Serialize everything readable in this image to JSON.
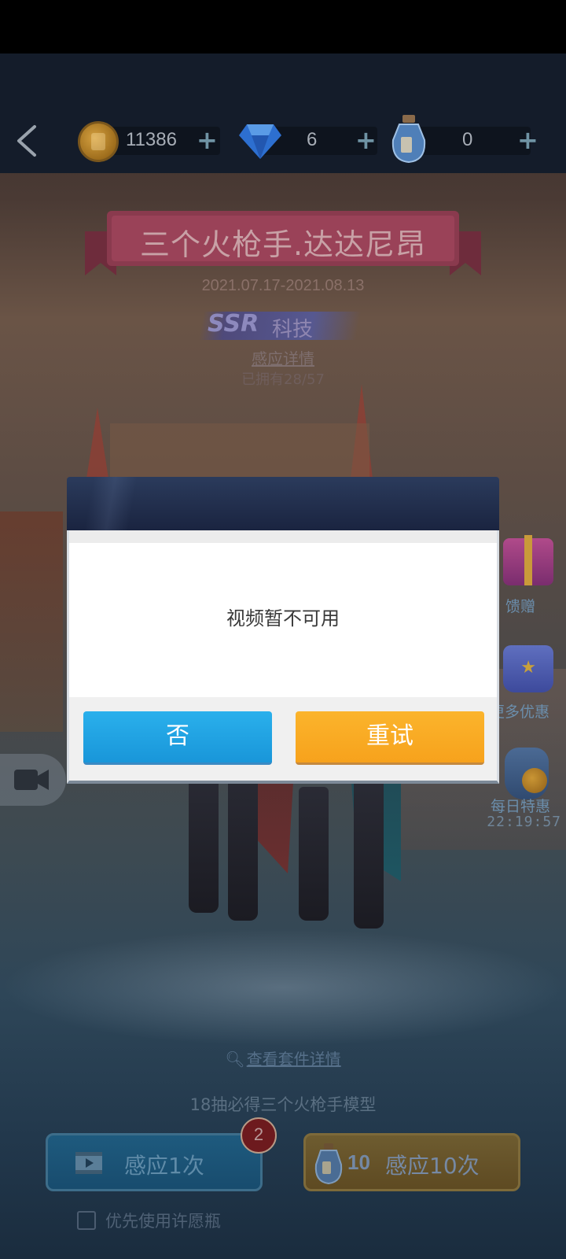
{
  "resources": {
    "coins": "11386",
    "gems": "6",
    "bottles": "0",
    "plus": "+"
  },
  "banner": {
    "title": "三个火枪手.达达尼昂",
    "date_range": "2021.07.17-2021.08.13",
    "rarity": "SSR",
    "category": "科技",
    "detail_link": "感应详情",
    "owned": "已拥有28/57"
  },
  "side_menu": {
    "gift_label": "馈赠",
    "more_deals_label": "更多优惠",
    "daily_deal_label": "每日特惠",
    "daily_deal_timer": "22:19:57"
  },
  "bottom": {
    "suit_link": "查看套件详情",
    "guarantee": "18抽必得三个火枪手模型",
    "draw_one_label": "感应1次",
    "draw_one_badge": "2",
    "draw_ten_cost": "10",
    "draw_ten_label": "感应10次",
    "wish_bottle_option": "优先使用许愿瓶"
  },
  "dialog": {
    "message": "视频暂不可用",
    "no_label": "否",
    "retry_label": "重试"
  },
  "colors": {
    "dialog_no": "#1fa3e3",
    "dialog_retry": "#f9ab24",
    "top_bar": "#141c2a"
  }
}
